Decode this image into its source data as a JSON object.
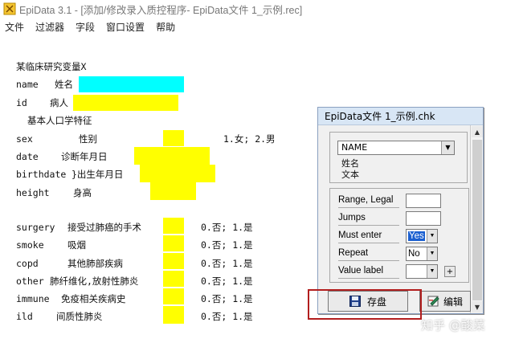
{
  "window": {
    "title": "EpiData 3.1 - [添加/修改录入质控程序- EpiData文件 1_示例.rec]"
  },
  "menu": [
    "文件",
    "过滤器",
    "字段",
    "窗口设置",
    "帮助"
  ],
  "form": {
    "heading": "某临床研究变量X",
    "subheading": "基本人口学特征",
    "rows": [
      {
        "name": "name",
        "label": "姓名"
      },
      {
        "name": "id",
        "label": "病人"
      },
      {
        "name": "sex",
        "label": "性别",
        "hint": "1.女; 2.男"
      },
      {
        "name": "date",
        "label": "诊断年月日"
      },
      {
        "name": "birthdate",
        "label": "}出生年月日"
      },
      {
        "name": "height",
        "label": "身高"
      },
      {
        "name": "surgery",
        "label": "接受过肺癌的手术",
        "hint": "0.否; 1.是"
      },
      {
        "name": "smoke",
        "label": "吸烟",
        "hint": "0.否; 1.是"
      },
      {
        "name": "copd",
        "label": "其他肺部疾病",
        "hint": "0.否; 1.是"
      },
      {
        "name": "other",
        "label": "肺纤维化,放射性肺炎",
        "hint": "0.否; 1.是"
      },
      {
        "name": "immune",
        "label": "免疫相关疾病史",
        "hint": "0.否; 1.是"
      },
      {
        "name": "ild",
        "label": "间质性肺炎",
        "hint": "0.否; 1.是"
      }
    ]
  },
  "dialog": {
    "title": "EpiData文件 1_示例.chk",
    "field_select": "NAME",
    "field_desc_line1": "姓名",
    "field_desc_line2": "文本",
    "range_label": "Range, Legal",
    "jumps_label": "Jumps",
    "must_enter_label": "Must enter",
    "must_enter_value": "Yes",
    "repeat_label": "Repeat",
    "repeat_value": "No",
    "value_label_label": "Value label",
    "plus": "+",
    "save_button": "存盘",
    "edit_button": "编辑"
  },
  "watermark": "知乎 @酸菜",
  "colors": {
    "field_yellow": "#ffff00",
    "field_cyan": "#00ffff",
    "highlight": "#b21e1e"
  }
}
